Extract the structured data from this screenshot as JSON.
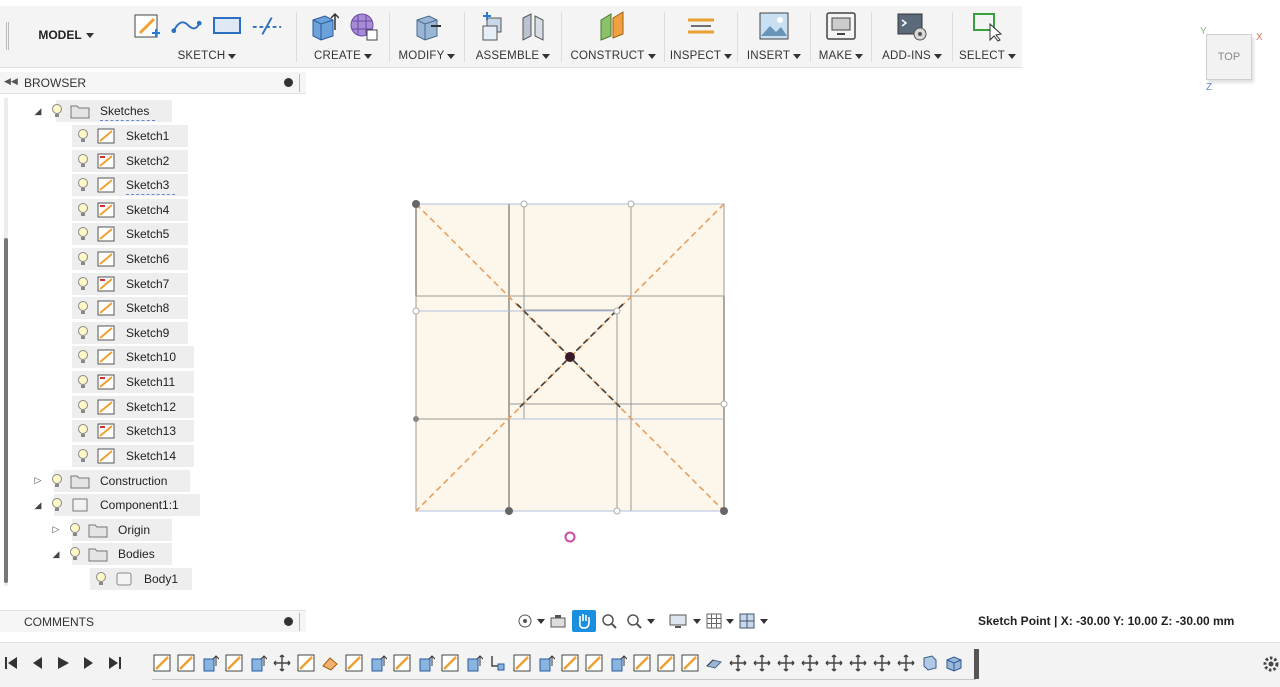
{
  "workspace": {
    "label": "MODEL"
  },
  "toolbar": {
    "groups": [
      {
        "label": "SKETCH"
      },
      {
        "label": "CREATE"
      },
      {
        "label": "MODIFY"
      },
      {
        "label": "ASSEMBLE"
      },
      {
        "label": "CONSTRUCT"
      },
      {
        "label": "INSPECT"
      },
      {
        "label": "INSERT"
      },
      {
        "label": "MAKE"
      },
      {
        "label": "ADD-INS"
      },
      {
        "label": "SELECT"
      }
    ]
  },
  "viewcube": {
    "face": "TOP",
    "axis_x": "X",
    "axis_y": "Y",
    "axis_z": "Z"
  },
  "browser": {
    "title": "BROWSER",
    "items": [
      {
        "label": "Sketches"
      },
      {
        "label": "Sketch1"
      },
      {
        "label": "Sketch2"
      },
      {
        "label": "Sketch3"
      },
      {
        "label": "Sketch4"
      },
      {
        "label": "Sketch5"
      },
      {
        "label": "Sketch6"
      },
      {
        "label": "Sketch7"
      },
      {
        "label": "Sketch8"
      },
      {
        "label": "Sketch9"
      },
      {
        "label": "Sketch10"
      },
      {
        "label": "Sketch11"
      },
      {
        "label": "Sketch12"
      },
      {
        "label": "Sketch13"
      },
      {
        "label": "Sketch14"
      },
      {
        "label": "Construction"
      },
      {
        "label": "Component1:1"
      },
      {
        "label": "Origin"
      },
      {
        "label": "Bodies"
      },
      {
        "label": "Body1"
      }
    ]
  },
  "comments": {
    "title": "COMMENTS"
  },
  "status": {
    "text": "Sketch Point | X: -30.00 Y: 10.00 Z: -30.00 mm"
  },
  "colors": {
    "accent": "#1a8fe0",
    "sketch_fill": "#fdf6ea",
    "construction_line": "#e8a060",
    "sketch_line": "#555555"
  }
}
